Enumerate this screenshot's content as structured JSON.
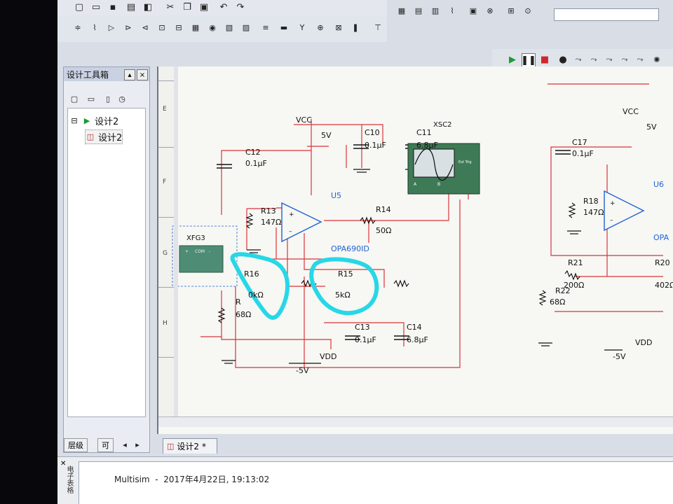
{
  "left_panel": {
    "title": "设计工具箱",
    "tree": [
      {
        "label": "设计2",
        "level": 0
      },
      {
        "label": "设计2",
        "level": 1
      }
    ],
    "tabs": [
      "层级",
      "可"
    ]
  },
  "document_tab": {
    "label": "设计2",
    "modified_mark": "*"
  },
  "ruler": {
    "rows": [
      "E",
      "F",
      "G",
      "H"
    ]
  },
  "schematic": {
    "left_circuit": {
      "vcc_label": "VCC",
      "vcc_value": "5V",
      "vdd_label": "VDD",
      "vdd_value": "-5V",
      "opamp_name": "U5",
      "opamp_part": "OPA690ID",
      "generator": "XFG3",
      "scope": "XSC2",
      "components": [
        {
          "ref": "C12",
          "value": "0.1μF"
        },
        {
          "ref": "C10",
          "value": "0.1μF"
        },
        {
          "ref": "C11",
          "value": "6.8μF"
        },
        {
          "ref": "R13",
          "value": "147Ω"
        },
        {
          "ref": "R14",
          "value": "50Ω"
        },
        {
          "ref": "R16",
          "value": "0kΩ"
        },
        {
          "ref": "R15",
          "value": "5kΩ"
        },
        {
          "ref": "R",
          "value": "68Ω"
        },
        {
          "ref": "C13",
          "value": "0.1μF"
        },
        {
          "ref": "C14",
          "value": "6.8μF"
        }
      ]
    },
    "right_circuit": {
      "vcc_label": "VCC",
      "vcc_value": "5V",
      "vdd_label": "VDD",
      "vdd_value": "-5V",
      "opamp_name": "U6",
      "opamp_part": "OPA",
      "components": [
        {
          "ref": "C17",
          "value": "0.1μF"
        },
        {
          "ref": "R18",
          "value": "147Ω"
        },
        {
          "ref": "R21",
          "value": "200Ω"
        },
        {
          "ref": "R20",
          "value": "402Ω"
        },
        {
          "ref": "R22",
          "value": "68Ω"
        }
      ]
    },
    "generator_pins": [
      "+",
      "COM",
      "-"
    ],
    "scope_pins": [
      "A",
      "B"
    ],
    "scope_trigger": "Ext Trig"
  },
  "status": {
    "message_app": "Multisim",
    "message_sep": "-",
    "message_time": "2017年4月22日, 19:13:02",
    "side_tab": "电子表格"
  },
  "colors": {
    "wire": "#d8343a",
    "highlight": "#27d7e6",
    "label_blue": "#1f63d6",
    "scope_green": "#3f7a56"
  }
}
